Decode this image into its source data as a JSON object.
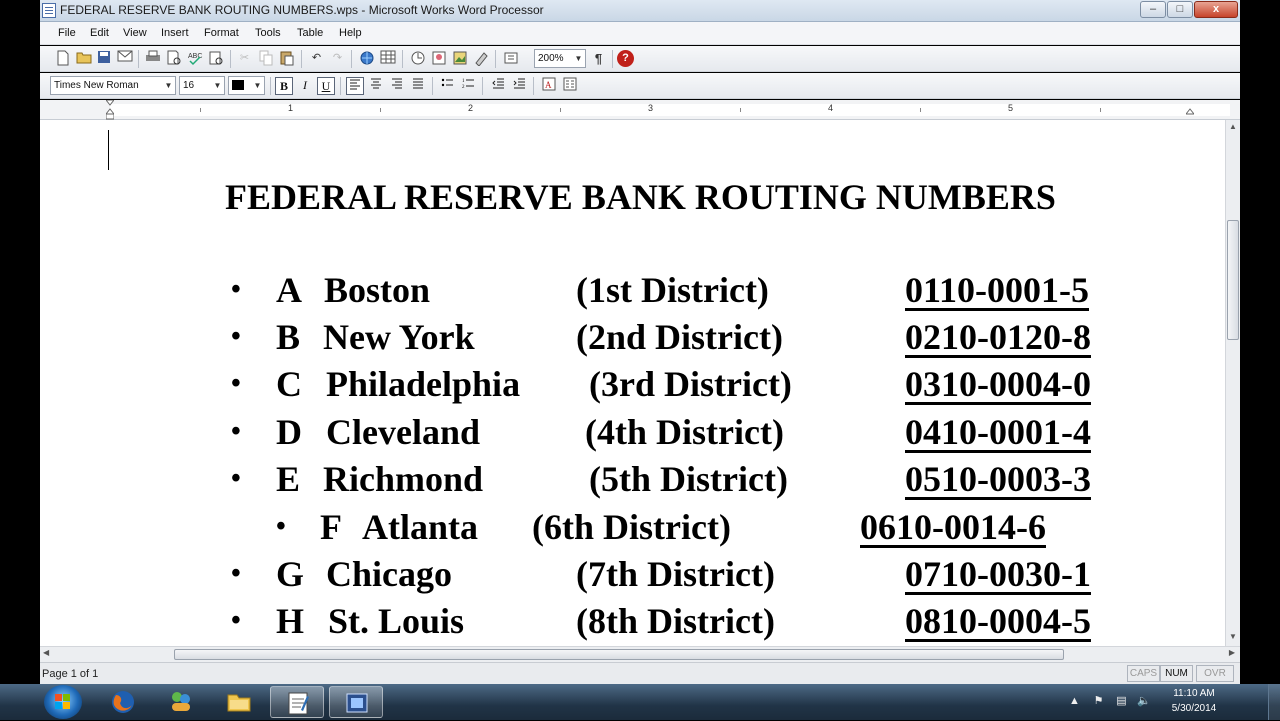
{
  "window": {
    "title": "FEDERAL RESERVE BANK ROUTING NUMBERS.wps - Microsoft Works Word Processor",
    "min_glyph": "–",
    "max_glyph": "□",
    "close_glyph": "x"
  },
  "menu": [
    "File",
    "Edit",
    "View",
    "Insert",
    "Format",
    "Tools",
    "Table",
    "Help"
  ],
  "toolbar": {
    "zoom": "200%",
    "pilcrow": "¶",
    "help_glyph": "?",
    "font_name": "Times New Roman",
    "font_size": "16",
    "bold": "B",
    "italic": "I",
    "underline": "U",
    "combo_arrow": "▼"
  },
  "ruler": {
    "numbers": [
      "1",
      "2",
      "3",
      "4",
      "5"
    ]
  },
  "document": {
    "title": "FEDERAL RESERVE BANK ROUTING NUMBERS",
    "bullet": "•",
    "rows": [
      {
        "letter": "A",
        "city": "Boston",
        "district": "(1st District)",
        "code": "0110-0001-5"
      },
      {
        "letter": "B",
        "city": "New York",
        "district": "(2nd District)",
        "code": "0210-0120-8"
      },
      {
        "letter": "C",
        "city": "Philadelphia",
        "district": "(3rd District)",
        "code": "0310-0004-0"
      },
      {
        "letter": "D",
        "city": "Cleveland",
        "district": "(4th District)",
        "code": "0410-0001-4"
      },
      {
        "letter": "E",
        "city": "Richmond",
        "district": "(5th District)",
        "code": "0510-0003-3"
      },
      {
        "letter": "F",
        "city": "Atlanta",
        "district": "(6th District)",
        "code": "0610-0014-6"
      },
      {
        "letter": "G",
        "city": "Chicago",
        "district": "(7th District)",
        "code": "0710-0030-1"
      },
      {
        "letter": "H",
        "city": "St. Louis",
        "district": "(8th District)",
        "code": "0810-0004-5"
      }
    ]
  },
  "status": {
    "page": "Page 1 of 1",
    "caps": "CAPS",
    "num": "NUM",
    "ovr": "OVR"
  },
  "taskbar": {
    "time": "11:10 AM",
    "date": "5/30/2014",
    "tray_arrow": "▲",
    "colors": {
      "start_orb": "#1f6ab8",
      "taskbar": "#213447"
    }
  }
}
